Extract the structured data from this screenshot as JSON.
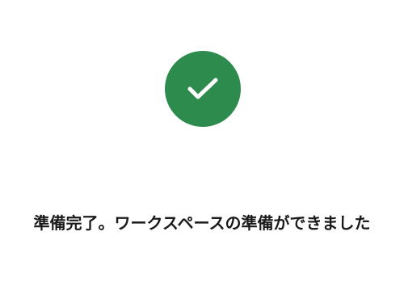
{
  "status": {
    "icon": "checkmark-icon",
    "accent_color": "#2e8b4e",
    "message": "準備完了。ワークスペースの準備ができました"
  }
}
